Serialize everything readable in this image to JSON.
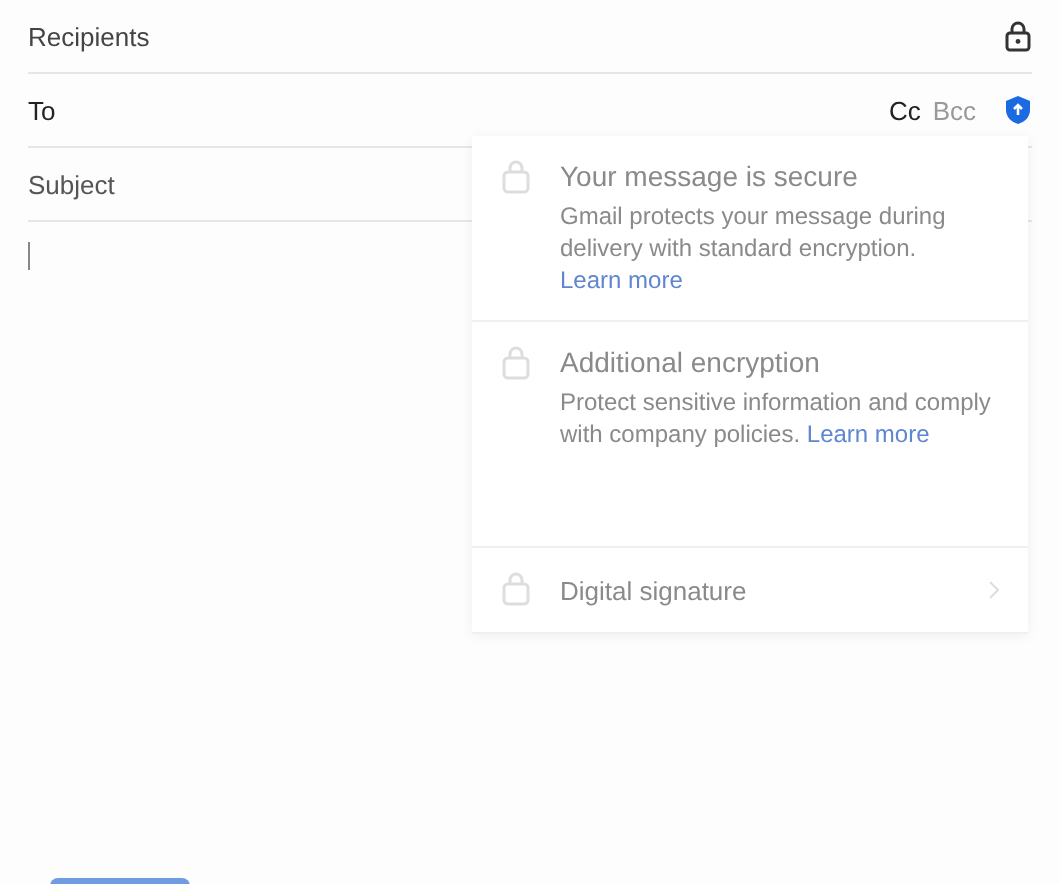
{
  "recipients": {
    "label": "Recipients"
  },
  "to": {
    "label": "To",
    "cc": "Cc",
    "bcc": "Bcc"
  },
  "subject": {
    "placeholder": "Subject"
  },
  "security_panel": {
    "sections": [
      {
        "title": "Your message is secure",
        "text": "Gmail protects your message during delivery with standard encryption.",
        "link": "Learn more"
      },
      {
        "title": "Additional encryption",
        "text": "Protect sensitive information and comply with company policies.",
        "link": "Learn more"
      },
      {
        "title": "Digital signature"
      }
    ]
  }
}
